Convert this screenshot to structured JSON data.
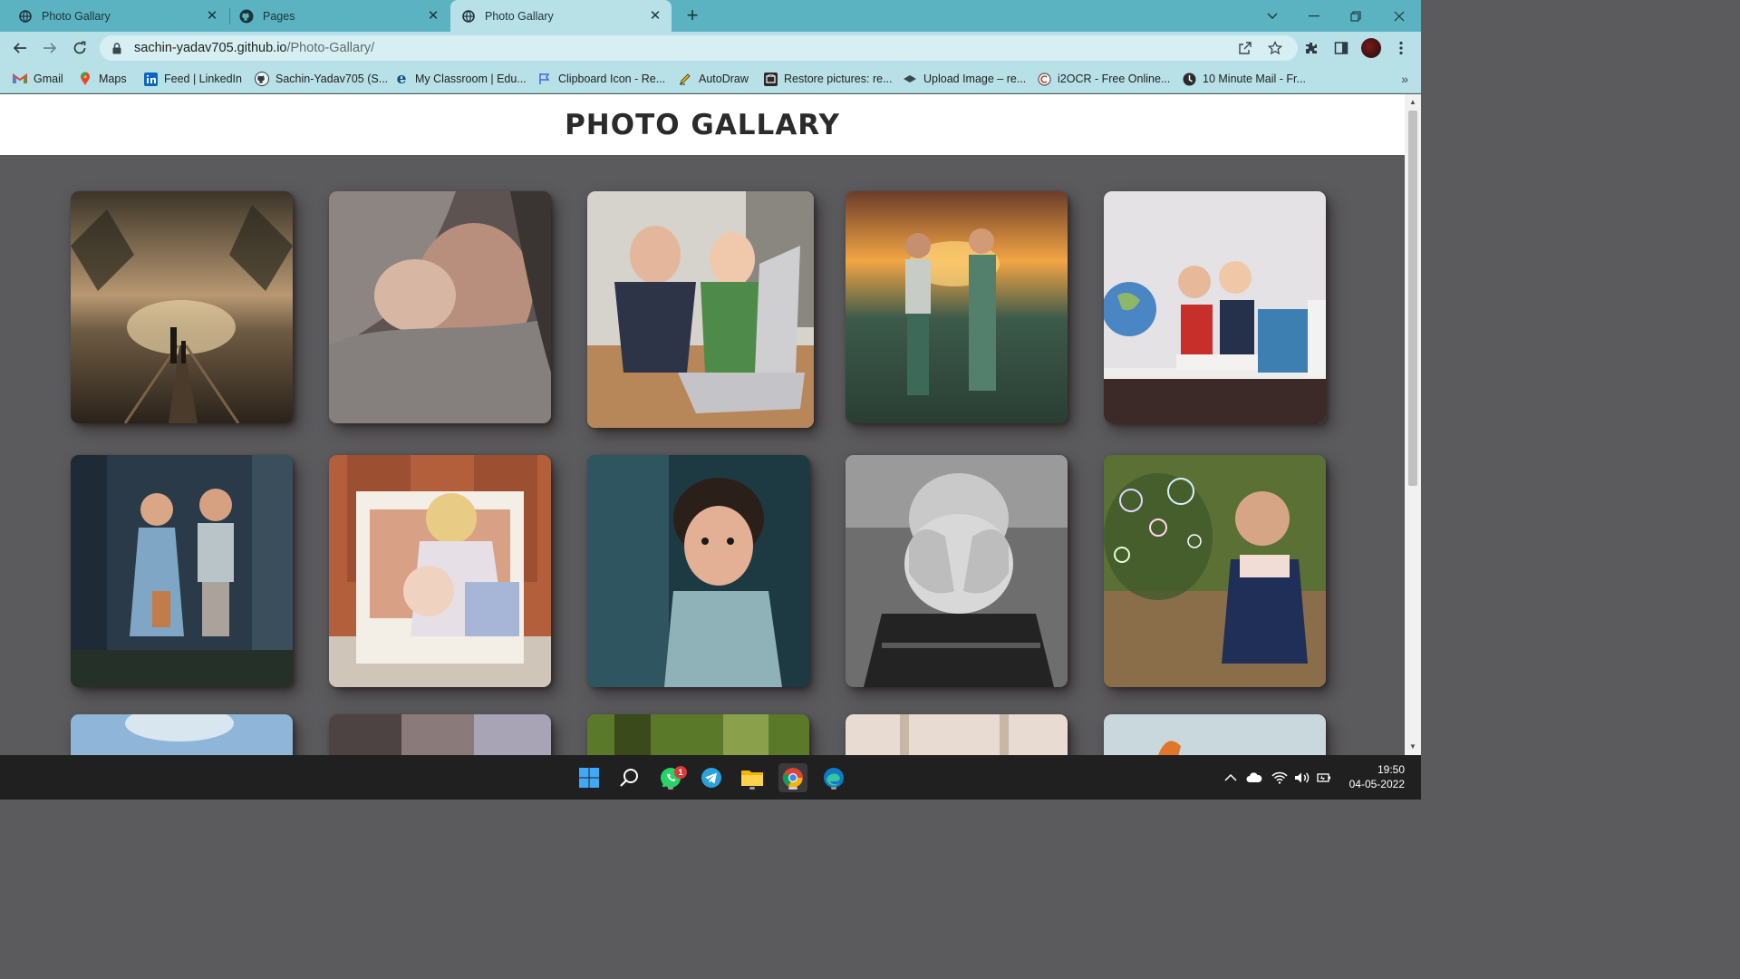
{
  "browser": {
    "tabs": [
      {
        "label": "Photo Gallary",
        "icon": "globe-icon",
        "active": false
      },
      {
        "label": "Pages",
        "icon": "github-icon",
        "active": false
      },
      {
        "label": "Photo Gallary",
        "icon": "globe-icon",
        "active": true
      }
    ],
    "url_host": "sachin-yadav705.github.io",
    "url_path": "/Photo-Gallary/",
    "bookmarks": [
      {
        "label": "Gmail",
        "icon": "gmail-icon"
      },
      {
        "label": "Maps",
        "icon": "maps-icon"
      },
      {
        "label": "Feed | LinkedIn",
        "icon": "linkedin-icon"
      },
      {
        "label": "Sachin-Yadav705 (S...",
        "icon": "github-icon"
      },
      {
        "label": "My Classroom | Edu...",
        "icon": "edureka-icon"
      },
      {
        "label": "Clipboard Icon - Re...",
        "icon": "flag-icon"
      },
      {
        "label": "AutoDraw",
        "icon": "pencil-icon"
      },
      {
        "label": "Restore pictures: re...",
        "icon": "restore-icon"
      },
      {
        "label": "Upload Image – re...",
        "icon": "upload-icon"
      },
      {
        "label": "i2OCR - Free Online...",
        "icon": "i2ocr-icon"
      },
      {
        "label": "10 Minute Mail - Fr...",
        "icon": "mail-icon"
      }
    ],
    "colors": {
      "tab_strip": "#5bb3c1",
      "toolbar": "#b8e0e7"
    }
  },
  "page": {
    "title": "PHOTO GALLARY",
    "background": "#5b5b5d",
    "photos": [
      {
        "name": "father-and-child-on-railway-tracks"
      },
      {
        "name": "father-with-sleeping-baby"
      },
      {
        "name": "kids-cheering-at-laptop"
      },
      {
        "name": "two-toddlers-holding-hands-at-sunset"
      },
      {
        "name": "two-boys-with-globe-and-books"
      },
      {
        "name": "two-children-in-forest"
      },
      {
        "name": "girl-hugging-baby-on-chair"
      },
      {
        "name": "curly-haired-boy-portrait"
      },
      {
        "name": "child-covering-face-black-and-white"
      },
      {
        "name": "girl-blowing-bubbles"
      },
      {
        "name": "sky-photo-partial"
      },
      {
        "name": "road-photo-partial"
      },
      {
        "name": "forest-photo-partial"
      },
      {
        "name": "room-photo-partial"
      },
      {
        "name": "toy-photo-partial"
      }
    ]
  },
  "taskbar": {
    "apps": [
      "windows-start-icon",
      "search-icon",
      "whatsapp-icon",
      "telegram-icon",
      "file-explorer-icon",
      "chrome-icon",
      "edge-icon"
    ],
    "whatsapp_badge": "1",
    "time": "19:50",
    "date": "04-05-2022"
  }
}
